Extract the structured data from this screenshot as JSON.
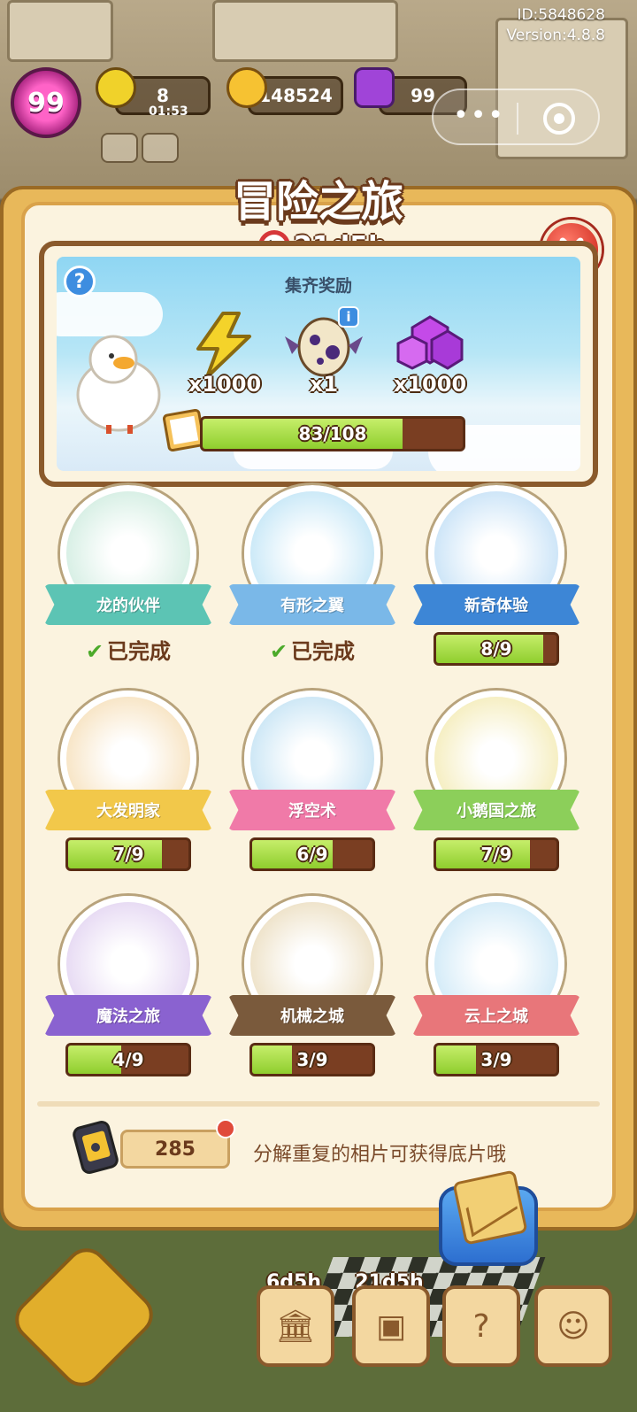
{
  "status": {
    "id_text": "ID:5848628",
    "version_text": "Version:4.8.8"
  },
  "hud": {
    "level": "99",
    "energy": "8",
    "energy_timer": "01:53",
    "coins": "148524",
    "gems": "99"
  },
  "panel": {
    "title": "冒险之旅",
    "timer": "21d5h",
    "collect_title": "集齐奖励",
    "rewards": [
      {
        "icon": "lightning-icon",
        "qty": "x1000"
      },
      {
        "icon": "egg-icon",
        "qty": "x1"
      },
      {
        "icon": "gem-icon",
        "qty": "x1000"
      }
    ],
    "total_progress": {
      "text": "83/108",
      "value": 83,
      "max": 108
    }
  },
  "albums": [
    {
      "name": "龙的伙伴",
      "status": "已完成",
      "done": true,
      "ribbon": "#5cc4b4",
      "bg": "#d9f0e6",
      "art": "map-icon"
    },
    {
      "name": "有形之翼",
      "status": "已完成",
      "done": true,
      "ribbon": "#7ab8e8",
      "bg": "#cdeaf8",
      "art": "bird-icon"
    },
    {
      "name": "新奇体验",
      "progress": "8/9",
      "value": 8,
      "max": 9,
      "ribbon": "#3d86d6",
      "bg": "#cfe6f8",
      "art": "backpack-icon"
    },
    {
      "name": "大发明家",
      "progress": "7/9",
      "value": 7,
      "max": 9,
      "ribbon": "#f2c84a",
      "bg": "#f8e6c8",
      "art": "ufo-icon"
    },
    {
      "name": "浮空术",
      "progress": "6/9",
      "value": 6,
      "max": 9,
      "ribbon": "#f07aa8",
      "bg": "#cfe8f6",
      "art": "paper-plane-icon"
    },
    {
      "name": "小鹅国之旅",
      "progress": "7/9",
      "value": 7,
      "max": 9,
      "ribbon": "#8ccf5a",
      "bg": "#f6efc4",
      "art": "feather-icon"
    },
    {
      "name": "魔法之旅",
      "progress": "4/9",
      "value": 4,
      "max": 9,
      "ribbon": "#8a62d0",
      "bg": "#e8dcf4",
      "art": "letter-icon"
    },
    {
      "name": "机械之城",
      "progress": "3/9",
      "value": 3,
      "max": 9,
      "ribbon": "#7a5a3c",
      "bg": "#efe4cc",
      "art": "gear-icon"
    },
    {
      "name": "云上之城",
      "progress": "3/9",
      "value": 3,
      "max": 9,
      "ribbon": "#e8767a",
      "bg": "#d6ecf8",
      "art": "wings-icon"
    }
  ],
  "footer": {
    "film_count": "285",
    "tip": "分解重复的相片可获得底片哦"
  },
  "bottom_nav": {
    "timers": [
      "6d5h",
      "21d5h"
    ]
  },
  "colors": {
    "progress_fill": "#8fce2e",
    "progress_track": "#7a3e22",
    "panel_bg": "#fbf3df",
    "close_red": "#d83a2c"
  }
}
